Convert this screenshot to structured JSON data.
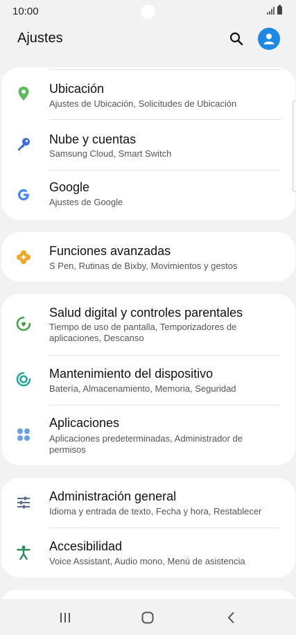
{
  "status_bar": {
    "time": "10:00"
  },
  "header": {
    "title": "Ajustes"
  },
  "cards": [
    {
      "items": [
        {
          "title": "Ubicación",
          "subtitle": "Ajustes de Ubicación, Solicitudes de Ubicación",
          "icon": "location-pin-icon",
          "color": "#5cb85c"
        },
        {
          "title": "Nube y cuentas",
          "subtitle": "Samsung Cloud, Smart Switch",
          "icon": "key-icon",
          "color": "#3d6fd6"
        },
        {
          "title": "Google",
          "subtitle": "Ajustes de Google",
          "icon": "google-icon",
          "color": "#4285f4"
        }
      ]
    },
    {
      "items": [
        {
          "title": "Funciones avanzadas",
          "subtitle": "S Pen, Rutinas de Bixby, Movimientos y gestos",
          "icon": "puzzle-gear-icon",
          "color": "#f5a623"
        }
      ]
    },
    {
      "items": [
        {
          "title": "Salud digital y controles parentales",
          "subtitle": "Tiempo de uso de pantalla, Temporizadores de aplicaciones, Descanso",
          "icon": "digital-wellbeing-icon",
          "color": "#43a047"
        },
        {
          "title": "Mantenimiento del dispositivo",
          "subtitle": "Batería, Almacenamiento, Memoria, Seguridad",
          "icon": "device-care-icon",
          "color": "#26a69a"
        },
        {
          "title": "Aplicaciones",
          "subtitle": "Aplicaciones predeterminadas, Administrador de permisos",
          "icon": "apps-grid-icon",
          "color": "#6aa0e8"
        }
      ]
    },
    {
      "items": [
        {
          "title": "Administración general",
          "subtitle": "Idioma y entrada de texto, Fecha y hora, Restablecer",
          "icon": "sliders-icon",
          "color": "#5b6b8c"
        },
        {
          "title": "Accesibilidad",
          "subtitle": "Voice Assistant, Audio mono, Menú de asistencia",
          "icon": "accessibility-icon",
          "color": "#2e8b57"
        }
      ]
    }
  ],
  "nav_bar": {
    "buttons": [
      "recent-apps-icon",
      "home-icon",
      "back-icon"
    ]
  }
}
